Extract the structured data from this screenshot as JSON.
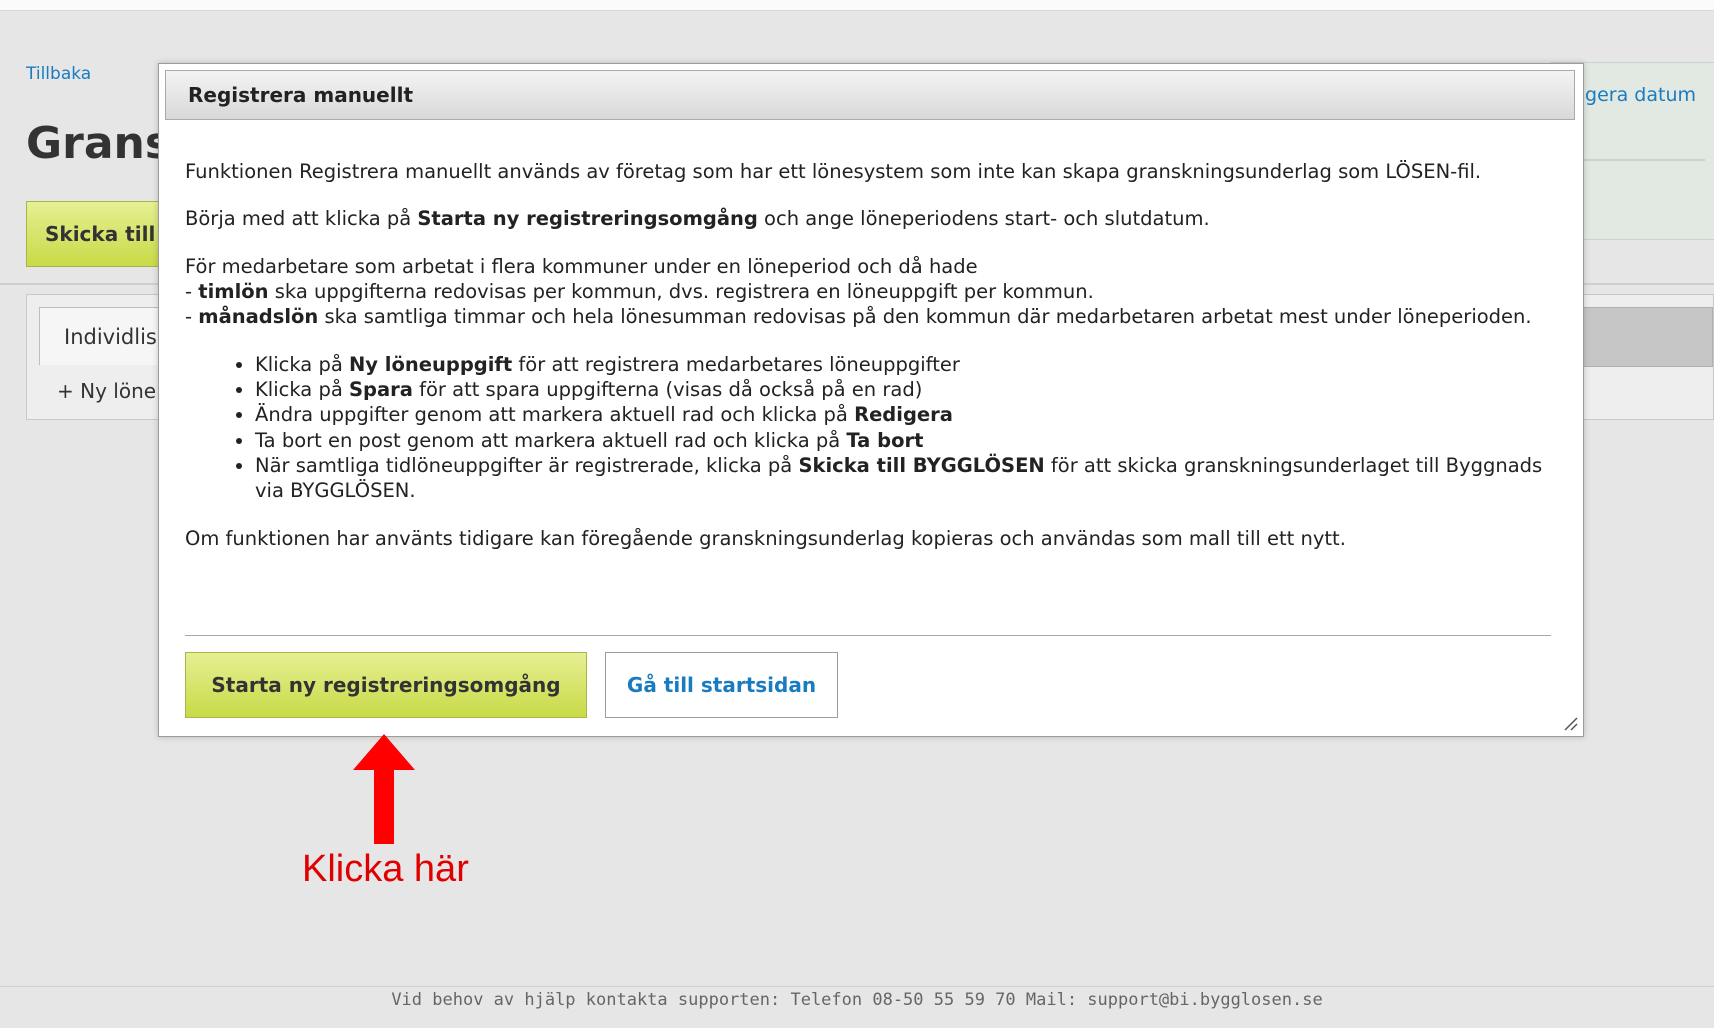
{
  "background": {
    "back_link": "Tillbaka",
    "page_title": "Grans",
    "right_link": "gera datum",
    "send_button": "Skicka till",
    "tab_label": "Individlis",
    "new_row": "+ Ny löne"
  },
  "modal": {
    "title": "Registrera manuellt",
    "p1": "Funktionen Registrera manuellt används av företag som har ett lönesystem som inte kan skapa granskningsunderlag som LÖSEN-fil.",
    "p2_prefix": "Börja med att klicka på ",
    "p2_bold": "Starta ny registreringsomgång",
    "p2_suffix": " och ange löneperiodens start- och slutdatum.",
    "p3_intro": "För medarbetare som arbetat i flera kommuner under en löneperiod och då hade",
    "p3_line1_prefix": "- ",
    "p3_line1_bold": "timlön",
    "p3_line1_suffix": " ska uppgifterna redovisas per kommun, dvs. registrera en löneuppgift per kommun.",
    "p3_line2_prefix": "- ",
    "p3_line2_bold": "månadslön",
    "p3_line2_suffix": " ska samtliga timmar och hela lönesumman redovisas på den kommun där medarbetaren arbetat mest under löneperioden.",
    "bullets": [
      {
        "prefix": "Klicka på ",
        "bold": "Ny löneuppgift",
        "suffix": " för att registrera medarbetares löneuppgifter"
      },
      {
        "prefix": "Klicka på ",
        "bold": "Spara",
        "suffix": " för att spara uppgifterna (visas då också på en rad)"
      },
      {
        "prefix": "Ändra uppgifter genom att markera aktuell rad och klicka på ",
        "bold": "Redigera",
        "suffix": ""
      },
      {
        "prefix": "Ta bort en post genom att markera aktuell rad och klicka på ",
        "bold": "Ta bort",
        "suffix": ""
      },
      {
        "prefix": "När samtliga tidlöneuppgifter är registrerade, klicka på ",
        "bold": "Skicka till BYGGLÖSEN",
        "suffix": " för att skicka granskningsunderlaget till Byggnads via BYGGLÖSEN."
      }
    ],
    "p4": "Om funktionen har använts tidigare kan föregående granskningsunderlag kopieras och användas som mall till ett nytt.",
    "start_button": "Starta ny registreringsomgång",
    "home_button": "Gå till startsidan"
  },
  "annotation": {
    "callout": "Klicka här",
    "color": "#e00000"
  },
  "footer": {
    "text": "Vid behov av hjälp kontakta supporten: Telefon 08-50 55 59 70 Mail: support@bi.bygglosen.se"
  }
}
